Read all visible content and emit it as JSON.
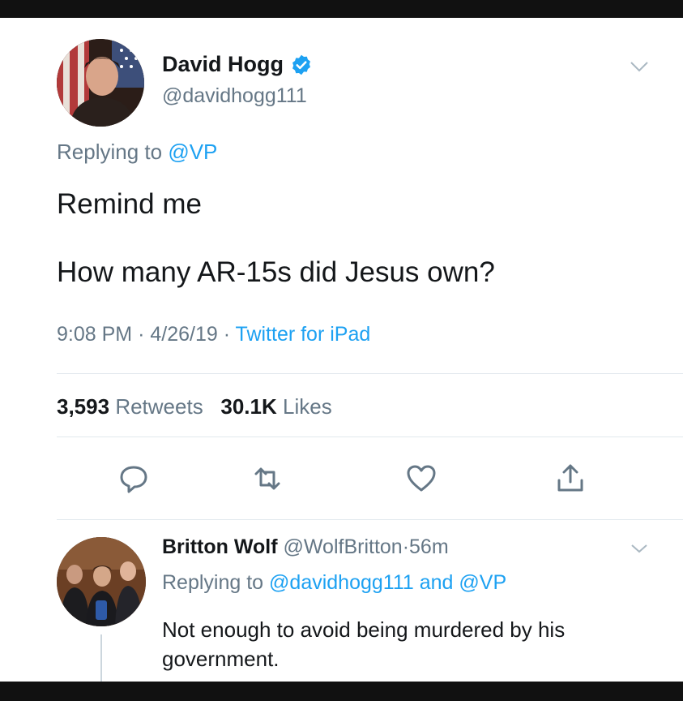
{
  "tweet": {
    "author_name": "David Hogg",
    "author_handle": "@davidhogg111",
    "replying_label": "Replying to",
    "replying_to": "@VP",
    "text_line1": "Remind me",
    "text_line2": "How many AR-15s did Jesus own?",
    "time": "9:08 PM",
    "date": "4/26/19",
    "source": "Twitter for iPad",
    "separator": "·",
    "retweets_count": "3,593",
    "retweets_label": "Retweets",
    "likes_count": "30.1K",
    "likes_label": "Likes"
  },
  "reply": {
    "author_name": "Britton Wolf",
    "author_handle": "@WolfBritton",
    "age": "56m",
    "separator": "·",
    "replying_label": "Replying to",
    "replying_to_1": "@davidhogg111",
    "and_label": "and",
    "replying_to_2": "@VP",
    "text": "Not enough to avoid being murdered by his government."
  },
  "icons": {
    "verified": "verified-badge-icon",
    "chevron": "chevron-down-icon",
    "reply": "reply-icon",
    "retweet": "retweet-icon",
    "like": "heart-icon",
    "share": "share-icon"
  },
  "colors": {
    "link": "#1da1f2",
    "secondary": "#657786",
    "text": "#14171a",
    "divider": "#e1e8ed"
  }
}
